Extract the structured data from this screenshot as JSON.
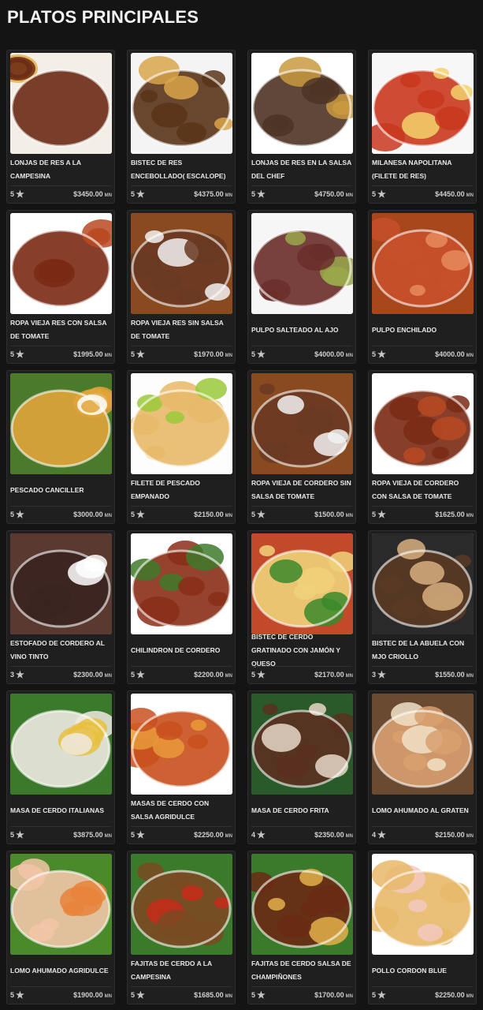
{
  "page": {
    "title": "PLATOS PRINCIPALES"
  },
  "dishes": [
    {
      "name": "LONJAS DE RES A LA CAMPESINA",
      "rating": "5",
      "price": "$3450.00",
      "currency": "MN",
      "image": "beef-strips-vegetables-fries-photo",
      "colors": [
        "#6b2a14",
        "#e3b04a",
        "#f3efe6"
      ]
    },
    {
      "name": "BISTEC DE RES ENCEBOLLADO( ESCALOPE)",
      "rating": "5",
      "price": "$4375.00",
      "currency": "MN",
      "image": "beef-steak-onions-photo",
      "colors": [
        "#5a3418",
        "#d8a64a",
        "#f4f4f4"
      ]
    },
    {
      "name": "LONJAS DE RES EN LA SALSA DEL CHEF",
      "rating": "5",
      "price": "$4750.00",
      "currency": "MN",
      "image": "beef-chef-sauce-fries-photo",
      "colors": [
        "#4e3424",
        "#c99a40",
        "#ffffff"
      ]
    },
    {
      "name": "MILANESA NAPOLITANA (FILETE DE RES)",
      "rating": "5",
      "price": "$4450.00",
      "currency": "MN",
      "image": "milanesa-napolitana-photo",
      "colors": [
        "#c9371e",
        "#f2d46b",
        "#f7f7f7"
      ]
    },
    {
      "name": "ROPA VIEJA RES CON SALSA DE TOMATE",
      "rating": "5",
      "price": "$1995.00",
      "currency": "MN",
      "image": "ropa-vieja-tomato-photo",
      "colors": [
        "#7a2a14",
        "#b84a22",
        "#ffffff"
      ]
    },
    {
      "name": "ROPA VIEJA RES SIN SALSA DE TOMATE",
      "rating": "5",
      "price": "$1970.00",
      "currency": "MN",
      "image": "ropa-vieja-rice-plantain-photo",
      "colors": [
        "#6a3a22",
        "#f2f2f2",
        "#8a4a20"
      ]
    },
    {
      "name": "PULPO SALTEADO AL AJO",
      "rating": "5",
      "price": "$4000.00",
      "currency": "MN",
      "image": "octopus-garlic-photo",
      "colors": [
        "#6a2e2a",
        "#9aa84a",
        "#f6f6f6"
      ]
    },
    {
      "name": "PULPO ENCHILADO",
      "rating": "5",
      "price": "$4000.00",
      "currency": "MN",
      "image": "octopus-enchilado-photo",
      "colors": [
        "#c7502a",
        "#e88a5a",
        "#a8461c"
      ]
    },
    {
      "name": "PESCADO CANCILLER",
      "rating": "5",
      "price": "$3000.00",
      "currency": "MN",
      "image": "fish-canciller-photo",
      "colors": [
        "#e0a43a",
        "#ffffff",
        "#4a7a2a"
      ]
    },
    {
      "name": "FILETE DE PESCADO EMPANADO",
      "rating": "5",
      "price": "$2150.00",
      "currency": "MN",
      "image": "breaded-fish-lime-photo",
      "colors": [
        "#e8b868",
        "#9bc93a",
        "#fdfdfd"
      ]
    },
    {
      "name": "ROPA VIEJA DE CORDERO SIN SALSA DE TOMATE",
      "rating": "5",
      "price": "$1500.00",
      "currency": "MN",
      "image": "lamb-ropa-vieja-photo",
      "colors": [
        "#6a3a22",
        "#f2f2f2",
        "#8a4a20"
      ]
    },
    {
      "name": "ROPA VIEJA DE CORDERO CON SALSA DE TOMATE",
      "rating": "5",
      "price": "$1625.00",
      "currency": "MN",
      "image": "lamb-ropa-vieja-tomato-photo",
      "colors": [
        "#7a2a14",
        "#b84a22",
        "#ffffff"
      ]
    },
    {
      "name": "ESTOFADO DE CORDERO AL VINO TINTO",
      "rating": "3",
      "price": "$2300.00",
      "currency": "MN",
      "image": "lamb-stew-red-wine-photo",
      "colors": [
        "#3a2420",
        "#ffffff",
        "#5a3a30"
      ]
    },
    {
      "name": "CHILINDRON DE CORDERO",
      "rating": "5",
      "price": "$2200.00",
      "currency": "MN",
      "image": "lamb-chilindron-photo",
      "colors": [
        "#8a2e18",
        "#3e7a2a",
        "#ffffff"
      ]
    },
    {
      "name": "BISTEC DE CERDO GRATINADO CON JAMóN Y QUESO",
      "rating": "5",
      "price": "$2170.00",
      "currency": "MN",
      "image": "pork-steak-gratin-photo",
      "colors": [
        "#f0d27a",
        "#3a8a2a",
        "#c24a2a"
      ]
    },
    {
      "name": "BISTEC DE LA ABUELA CON MJO CRIOLLO",
      "rating": "3",
      "price": "$1550.00",
      "currency": "MN",
      "image": "abuela-steak-mojo-photo",
      "colors": [
        "#5a3a24",
        "#d8b080",
        "#2a2a2a"
      ]
    },
    {
      "name": "MASA DE CERDO ITALIANAS",
      "rating": "5",
      "price": "$3875.00",
      "currency": "MN",
      "image": "pork-italian-cream-photo",
      "colors": [
        "#eeeae2",
        "#e8c040",
        "#3a7a2a"
      ]
    },
    {
      "name": "MASAS DE CERDO CON SALSA AGRIDULCE",
      "rating": "5",
      "price": "$2250.00",
      "currency": "MN",
      "image": "sweet-sour-pork-photo",
      "colors": [
        "#c9501e",
        "#e89a3a",
        "#ffffff"
      ]
    },
    {
      "name": "MASA DE CERDO FRITA",
      "rating": "4",
      "price": "$2350.00",
      "currency": "MN",
      "image": "fried-pork-chunks-photo",
      "colors": [
        "#5a3020",
        "#e8d8c8",
        "#2a5a2a"
      ]
    },
    {
      "name": "LOMO AHUMADO AL GRATEN",
      "rating": "4",
      "price": "$2150.00",
      "currency": "MN",
      "image": "smoked-loin-gratin-photo",
      "colors": [
        "#d8a070",
        "#f0e0c8",
        "#6a4a30"
      ]
    },
    {
      "name": "LOMO AHUMADO AGRIDULCE",
      "rating": "5",
      "price": "$1900.00",
      "currency": "MN",
      "image": "smoked-loin-sweet-sour-photo",
      "colors": [
        "#f2c6a8",
        "#e8823a",
        "#4a8a2a"
      ]
    },
    {
      "name": "FAJITAS DE CERDO A LA CAMPESINA",
      "rating": "5",
      "price": "$1685.00",
      "currency": "MN",
      "image": "pork-fajitas-campesina-photo",
      "colors": [
        "#7a4a22",
        "#c82a1a",
        "#3a7a2a"
      ]
    },
    {
      "name": "FAJITAS DE CERDO SALSA DE CHAMPIÑONES",
      "rating": "5",
      "price": "$1700.00",
      "currency": "MN",
      "image": "pork-fajitas-mushroom-photo",
      "colors": [
        "#6b2a14",
        "#e3b04a",
        "#3a7a2a"
      ]
    },
    {
      "name": "POLLO CORDON BLUE",
      "rating": "5",
      "price": "$2250.00",
      "currency": "MN",
      "image": "chicken-cordon-bleu-photo",
      "colors": [
        "#e8b868",
        "#f2c8c0",
        "#ffffff"
      ]
    }
  ]
}
